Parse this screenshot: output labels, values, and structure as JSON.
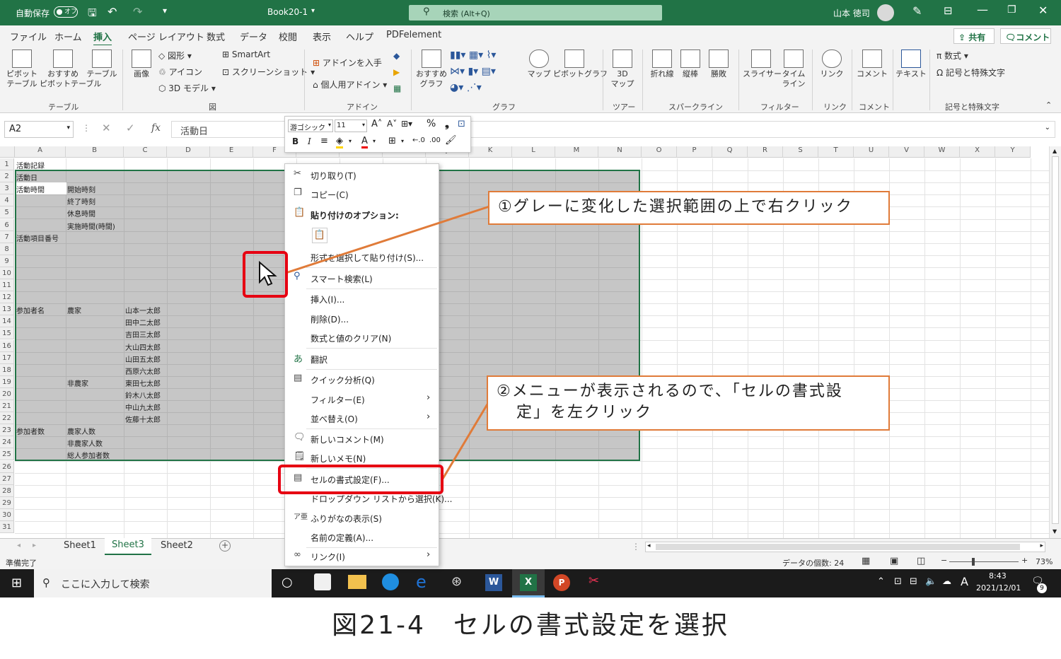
{
  "titlebar": {
    "autosave": "自動保存",
    "autosave_state": "オフ",
    "book": "Book20-1",
    "search": "検索 (Alt+Q)",
    "user": "山本 徳司"
  },
  "ribbon_tabs": [
    "ファイル",
    "ホーム",
    "挿入",
    "ページ レイアウト",
    "数式",
    "データ",
    "校閲",
    "表示",
    "ヘルプ",
    "PDFelement"
  ],
  "ribbon_right": {
    "share": "共有",
    "comment": "コメント"
  },
  "ribbon": {
    "pivot": "ピボット\nテーブル",
    "recommended_pivot": "おすすめ\nピボットテーブル",
    "table": "テーブル",
    "image": "画像",
    "shapes": "図形",
    "icons": "アイコン",
    "model3d": "3D モデル",
    "smartart": "SmartArt",
    "screenshot": "スクリーンショット",
    "get_addins": "アドインを入手",
    "my_addins": "個人用アドイン",
    "recommended_charts": "おすすめ\nグラフ",
    "maps": "マップ",
    "pivot_chart": "ピボットグラフ",
    "map3d": "3D\nマップ",
    "spark_line": "折れ線",
    "spark_col": "縦棒",
    "spark_win": "勝敗",
    "slicer": "スライサー",
    "timeline": "タイム\nライン",
    "link": "リンク",
    "comment": "コメント",
    "text": "テキスト",
    "equation": "数式",
    "symbol": "記号と特殊文字",
    "groups": {
      "table": "テーブル",
      "illust": "図",
      "addin": "アドイン",
      "chart": "グラフ",
      "tour": "ツアー",
      "sparkline": "スパークライン",
      "filter": "フィルター",
      "link": "リンク",
      "comment": "コメント",
      "symbol": "記号と特殊文字"
    }
  },
  "formula": {
    "namebox": "A2",
    "value": "活動日",
    "fx": "fx"
  },
  "mini_toolbar": {
    "font": "游ゴシック",
    "size": "11"
  },
  "columns": [
    "A",
    "B",
    "C",
    "D",
    "E",
    "F",
    "G",
    "H",
    "I",
    "J",
    "K",
    "L",
    "M",
    "N",
    "O",
    "P",
    "Q",
    "R",
    "S",
    "T",
    "U",
    "V",
    "W",
    "X",
    "Y"
  ],
  "rows": [
    "1",
    "2",
    "3",
    "4",
    "5",
    "6",
    "7",
    "8",
    "9",
    "10",
    "11",
    "12",
    "13",
    "14",
    "15",
    "16",
    "17",
    "18",
    "19",
    "20",
    "21",
    "22",
    "23",
    "24",
    "25",
    "26",
    "27",
    "28",
    "29",
    "30",
    "31"
  ],
  "cells": {
    "a1": "活動記録",
    "a2": "活動日",
    "a3": "活動時間",
    "b3": "開始時刻",
    "b4": "終了時刻",
    "b5": "休息時間",
    "b6": "実施時間(時間)",
    "a7": "活動項目番号",
    "a13": "参加者名",
    "b13": "農家",
    "c13": "山本一太郎",
    "c14": "田中二太郎",
    "c15": "吉田三太郎",
    "c16": "大山四太郎",
    "c17": "山田五太郎",
    "c18": "西原六太郎",
    "b19": "非農家",
    "c19": "東田七太郎",
    "c20": "鈴木八太郎",
    "c21": "中山九太郎",
    "c22": "佐藤十太郎",
    "a23": "参加者数",
    "b23": "農家人数",
    "b24": "非農家人数",
    "b25": "総人参加者数"
  },
  "context_menu": {
    "cut": "切り取り(T)",
    "copy": "コピー(C)",
    "paste_options": "貼り付けのオプション:",
    "paste_special": "形式を選択して貼り付け(S)...",
    "smart_lookup": "スマート検索(L)",
    "insert": "挿入(I)...",
    "delete": "削除(D)...",
    "clear": "数式と値のクリア(N)",
    "translate": "翻訳",
    "quick_analysis": "クイック分析(Q)",
    "filter": "フィルター(E)",
    "sort": "並べ替え(O)",
    "new_comment": "新しいコメント(M)",
    "new_note": "新しいメモ(N)",
    "format_cells": "セルの書式設定(F)...",
    "dropdown": "ドロップダウン リストから選択(K)...",
    "phonetic": "ふりがなの表示(S)",
    "define_name": "名前の定義(A)...",
    "link": "リンク(I)"
  },
  "callouts": {
    "step1": "①グレーに変化した選択範囲の上で右クリック",
    "step2_line1": "②メニューが表示されるので、「セルの書式設",
    "step2_line2": "定」を左クリック"
  },
  "sheets": [
    "Sheet1",
    "Sheet3",
    "Sheet2"
  ],
  "active_sheet": "Sheet3",
  "status": {
    "ready": "準備完了",
    "count": "データの個数: 24",
    "zoom": "73%"
  },
  "taskbar": {
    "search": "ここに入力して検索",
    "time": "8:43",
    "date": "2021/12/01",
    "ime": "A",
    "notif": "9"
  },
  "caption": "図21-4　セルの書式設定を選択",
  "colors": {
    "excel_green": "#217346",
    "callout_orange": "#e07b39",
    "highlight_red": "#e60012",
    "selection_gray": "#c6c6c6"
  }
}
